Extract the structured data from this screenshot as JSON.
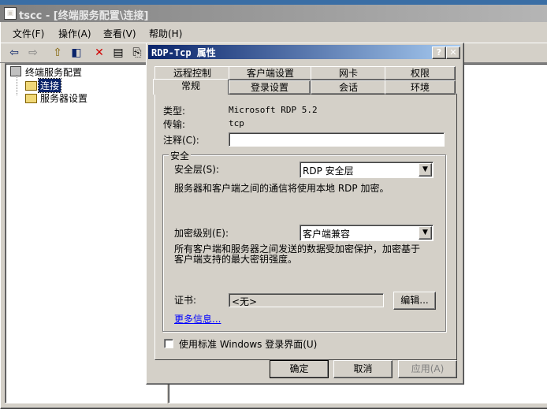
{
  "main_window": {
    "title": "tscc - [终端服务配置\\连接]",
    "menu": [
      "文件(F)",
      "操作(A)",
      "查看(V)",
      "帮助(H)"
    ],
    "tree": {
      "root": "终端服务配置",
      "items": [
        "连接",
        "服务器设置"
      ]
    }
  },
  "dialog": {
    "title": "RDP-Tcp 属性",
    "help_button": "?",
    "close_button": "✕",
    "tabs_row1": [
      "远程控制",
      "客户端设置",
      "网卡",
      "权限"
    ],
    "tabs_row2": [
      "常规",
      "登录设置",
      "会话",
      "环境"
    ],
    "active_tab": "常规",
    "type_label": "类型:",
    "type_value": "Microsoft RDP 5.2",
    "transport_label": "传输:",
    "transport_value": "tcp",
    "comment_label": "注释(C):",
    "comment_value": "",
    "security_group": "安全",
    "security_layer_label": "安全层(S):",
    "security_layer_value": "RDP 安全层",
    "security_layer_desc": "服务器和客户端之间的通信将使用本地 RDP 加密。",
    "encryption_label": "加密级别(E):",
    "encryption_value": "客户端兼容",
    "encryption_desc_1": "所有客户端和服务器之间发送的数据受加密保护，加密基于",
    "encryption_desc_2": "客户端支持的最大密钥强度。",
    "certificate_label": "证书:",
    "certificate_value": "<无>",
    "edit_button": "编辑...",
    "more_info_link": "更多信息...",
    "checkbox_label": "使用标准 Windows 登录界面(U)",
    "checkbox_checked": false,
    "ok_button": "确定",
    "cancel_button": "取消",
    "apply_button": "应用(A)"
  }
}
